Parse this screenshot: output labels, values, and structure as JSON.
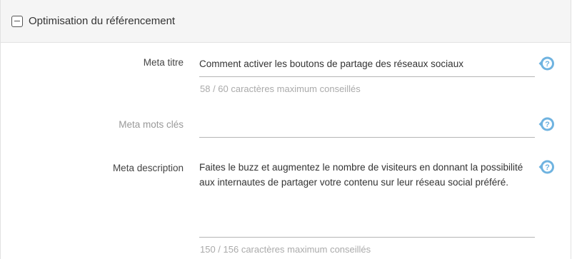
{
  "section": {
    "title": "Optimisation du référencement",
    "collapse_icon": "minus-square-icon"
  },
  "fields": {
    "meta_title": {
      "label": "Meta titre",
      "value": "Comment activer les boutons de partage des réseaux sociaux",
      "hint": "58 / 60 caractères maximum conseillés"
    },
    "meta_keywords": {
      "label": "Meta mots clés",
      "value": ""
    },
    "meta_description": {
      "label": "Meta description",
      "value": "Faites le buzz et augmentez le nombre de visiteurs en donnant la possibilité aux internautes de partager votre contenu sur leur réseau social préféré.",
      "hint": "150 / 156 caractères maximum conseillés"
    }
  },
  "colors": {
    "help_icon": "#6fb3e0",
    "header_bg": "#f5f5f5",
    "underline": "#b5b5b5"
  }
}
